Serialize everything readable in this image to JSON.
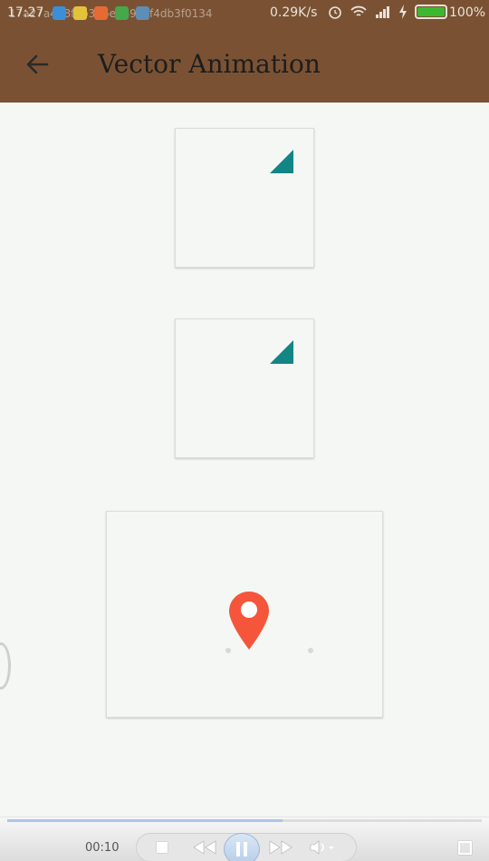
{
  "status_bar": {
    "time": "17:27",
    "ghost_text": "17a27a4b8f8b306e2693cf4db3f0134",
    "network_speed": "0.29K/s",
    "battery_pct": "100%",
    "notification_icons": [
      "usb-icon",
      "weibo-icon",
      "message-icon",
      "wechat-icon",
      "tool-icon"
    ]
  },
  "app_bar": {
    "title": "Vector Animation",
    "background_color": "#7a5233"
  },
  "cards": [
    {
      "name": "animated-corner-triangle-1",
      "accent_color": "#128585"
    },
    {
      "name": "animated-corner-triangle-2",
      "accent_color": "#128585"
    },
    {
      "name": "location-pin-animation",
      "accent_color": "#f4553b"
    }
  ],
  "player": {
    "elapsed": "00:10",
    "progress_fraction": 0.58
  }
}
